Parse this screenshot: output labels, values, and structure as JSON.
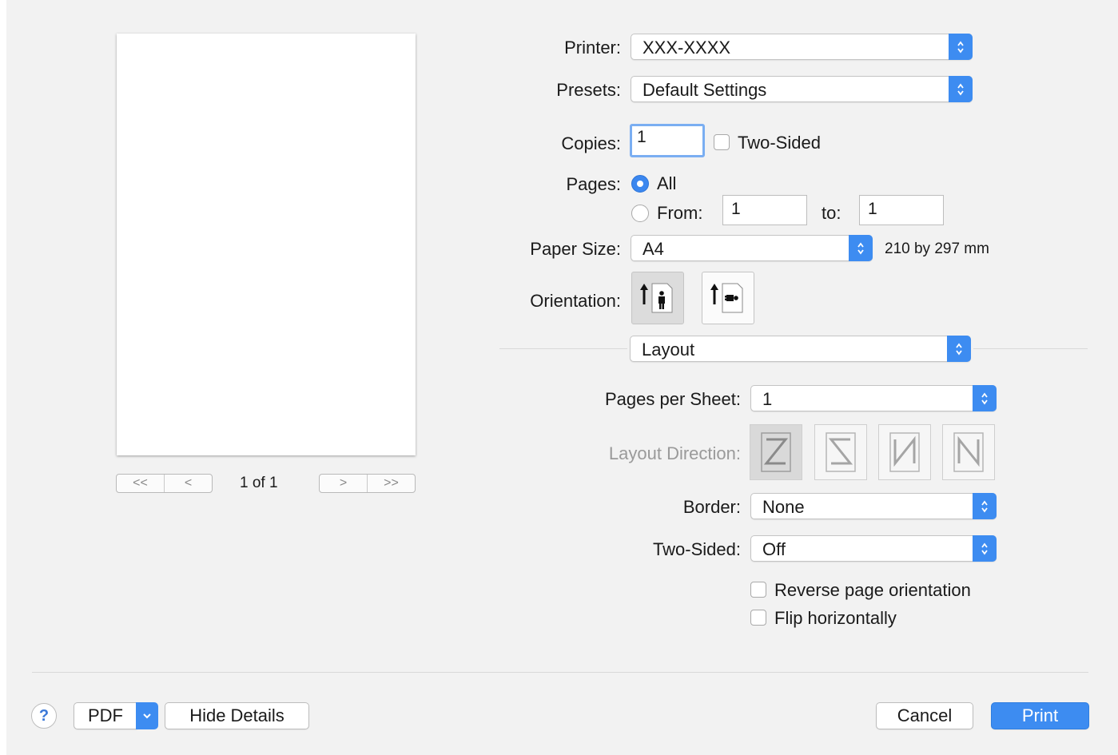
{
  "preview": {
    "page_info": "1 of 1",
    "first_glyph": "<<",
    "prev_glyph": "<",
    "next_glyph": ">",
    "last_glyph": ">>"
  },
  "printer": {
    "label": "Printer:",
    "value": "XXX-XXXX"
  },
  "presets": {
    "label": "Presets:",
    "value": "Default Settings"
  },
  "copies": {
    "label": "Copies:",
    "value": "1",
    "two_sided_label": "Two-Sided",
    "two_sided_checked": false
  },
  "pages": {
    "label": "Pages:",
    "all_label": "All",
    "from_label": "From:",
    "from_value": "1",
    "to_label": "to:",
    "to_value": "1",
    "selected": "All"
  },
  "paper_size": {
    "label": "Paper Size:",
    "value": "A4",
    "dimensions": "210 by 297 mm"
  },
  "orientation": {
    "label": "Orientation:",
    "options": [
      "portrait",
      "landscape"
    ],
    "selected": "portrait"
  },
  "section_popup": {
    "value": "Layout"
  },
  "layout": {
    "pages_per_sheet": {
      "label": "Pages per Sheet:",
      "value": "1"
    },
    "layout_direction": {
      "label": "Layout Direction:",
      "options": [
        "Z",
        "reverse-Z",
        "reverse-N",
        "N"
      ],
      "selected": "Z",
      "enabled": false
    },
    "border": {
      "label": "Border:",
      "value": "None"
    },
    "two_sided": {
      "label": "Two-Sided:",
      "value": "Off"
    },
    "reverse_orientation": {
      "label": "Reverse page orientation",
      "checked": false
    },
    "flip_horizontally": {
      "label": "Flip horizontally",
      "checked": false
    }
  },
  "footer": {
    "help_glyph": "?",
    "pdf_label": "PDF",
    "hide_details_label": "Hide Details",
    "cancel_label": "Cancel",
    "print_label": "Print"
  },
  "colors": {
    "accent": "#3d8cf1",
    "background": "#f2f2f2"
  }
}
